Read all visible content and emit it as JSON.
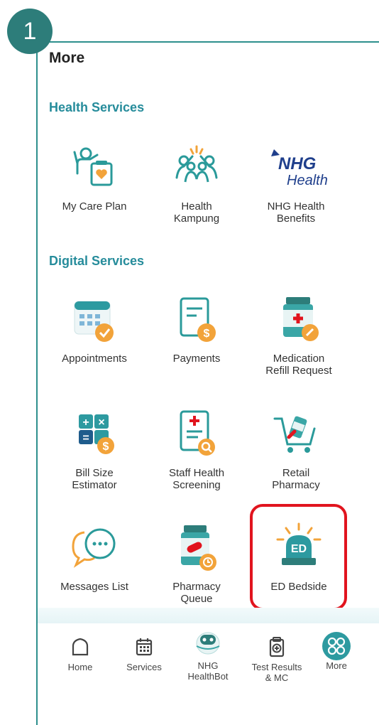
{
  "step_badge": "1",
  "page_title": "More",
  "sections": {
    "health_services": "Health Services",
    "digital_services": "Digital Services"
  },
  "tiles": {
    "my_care_plan": [
      "My Care Plan"
    ],
    "health_kampung": [
      "Health",
      "Kampung"
    ],
    "nhg_health_benefits": [
      "NHG Health",
      "Benefits"
    ],
    "appointments": [
      "Appointments"
    ],
    "payments": [
      "Payments"
    ],
    "medication_refill": [
      "Medication",
      "Refill Request"
    ],
    "bill_size_estimator": [
      "Bill Size",
      "Estimator"
    ],
    "staff_health_screening": [
      "Staff Health",
      "Screening"
    ],
    "retail_pharmacy": [
      "Retail",
      "Pharmacy"
    ],
    "messages_list": [
      "Messages List"
    ],
    "pharmacy_queue": [
      "Pharmacy",
      "Queue"
    ],
    "ed_bedside": [
      "ED Bedside"
    ]
  },
  "logo": {
    "nhg": "NHG",
    "health": "Health"
  },
  "icon_text": {
    "ed": "ED",
    "plus": "+",
    "times": "×",
    "equals": "=",
    "dollar": "$"
  },
  "nav": {
    "home": [
      "Home"
    ],
    "services": [
      "Services"
    ],
    "healthbot": [
      "NHG",
      "HealthBot"
    ],
    "test_results": [
      "Test Results",
      "& MC"
    ],
    "more": [
      "More"
    ]
  },
  "colors": {
    "teal": "#2d8f8d",
    "accent_orange": "#f2a33a",
    "highlight_red": "#e1141e",
    "section_blue": "#268c9b"
  },
  "icons": [
    "caregiver-icon",
    "community-icon",
    "nhg-logo",
    "calendar-check-icon",
    "bill-dollar-icon",
    "medicine-bottle-icon",
    "calculator-icon",
    "screening-report-icon",
    "shopping-cart-icon",
    "chat-bubbles-icon",
    "pill-bottle-clock-icon",
    "siren-icon",
    "home-icon",
    "services-icon",
    "healthbot-icon",
    "test-results-icon",
    "more-grid-icon"
  ]
}
